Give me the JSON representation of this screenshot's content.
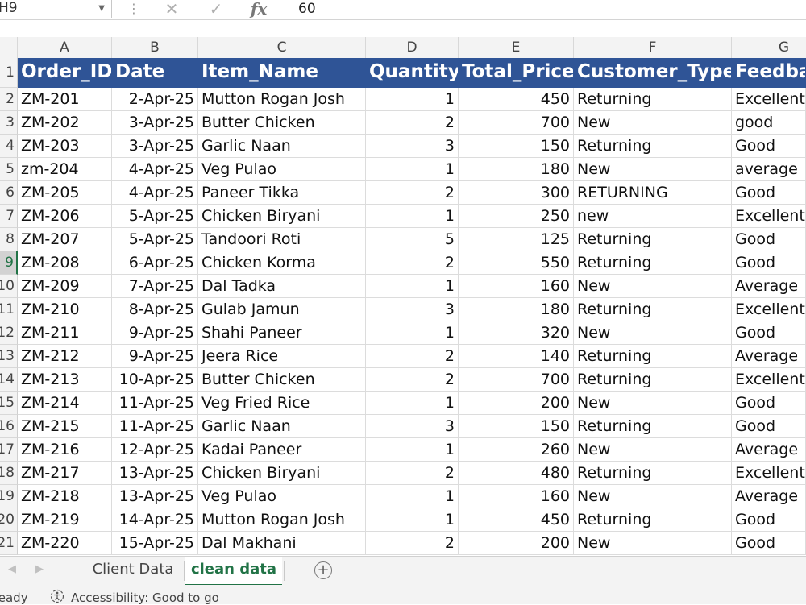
{
  "formula_bar": {
    "cell_ref": "H9",
    "value": "60"
  },
  "columns": [
    "A",
    "B",
    "C",
    "D",
    "E",
    "F",
    "G"
  ],
  "row_numbers": [
    "1",
    "2",
    "3",
    "4",
    "5",
    "6",
    "7",
    "8",
    "9",
    "10",
    "11",
    "12",
    "13",
    "14",
    "15",
    "16",
    "17",
    "18",
    "19",
    "20",
    "21"
  ],
  "active_row": "9",
  "header": [
    "Order_ID",
    "Date",
    "Item_Name",
    "Quantity",
    "Total_Price",
    "Customer_Type",
    "Feedback"
  ],
  "rows": [
    [
      "ZM-201",
      "2-Apr-25",
      "Mutton Rogan Josh",
      "1",
      "450",
      "Returning",
      "Excellent"
    ],
    [
      "ZM-202",
      "3-Apr-25",
      "Butter Chicken",
      "2",
      "700",
      "New",
      "good"
    ],
    [
      "ZM-203",
      "3-Apr-25",
      "Garlic Naan",
      "3",
      "150",
      "Returning",
      "Good"
    ],
    [
      "zm-204",
      "4-Apr-25",
      "Veg Pulao",
      "1",
      "180",
      "New",
      "average"
    ],
    [
      "ZM-205",
      "4-Apr-25",
      "Paneer Tikka",
      "2",
      "300",
      "RETURNING",
      "Good"
    ],
    [
      "ZM-206",
      "5-Apr-25",
      "Chicken Biryani",
      "1",
      "250",
      "new",
      "Excellent"
    ],
    [
      "ZM-207",
      "5-Apr-25",
      "Tandoori Roti",
      "5",
      "125",
      "Returning",
      "Good"
    ],
    [
      "ZM-208",
      "6-Apr-25",
      "Chicken Korma",
      "2",
      "550",
      "Returning",
      "Good"
    ],
    [
      "ZM-209",
      "7-Apr-25",
      "Dal Tadka",
      "1",
      "160",
      "New",
      "Average"
    ],
    [
      "ZM-210",
      "8-Apr-25",
      "Gulab Jamun",
      "3",
      "180",
      "Returning",
      "Excellent"
    ],
    [
      "ZM-211",
      "9-Apr-25",
      "Shahi Paneer",
      "1",
      "320",
      "New",
      "Good"
    ],
    [
      "ZM-212",
      "9-Apr-25",
      "Jeera Rice",
      "2",
      "140",
      "Returning",
      "Average"
    ],
    [
      "ZM-213",
      "10-Apr-25",
      "Butter Chicken",
      "2",
      "700",
      "Returning",
      "Excellent"
    ],
    [
      "ZM-214",
      "11-Apr-25",
      "Veg Fried Rice",
      "1",
      "200",
      "New",
      "Good"
    ],
    [
      "ZM-215",
      "11-Apr-25",
      "Garlic Naan",
      "3",
      "150",
      "Returning",
      "Good"
    ],
    [
      "ZM-216",
      "12-Apr-25",
      "Kadai Paneer",
      "1",
      "260",
      "New",
      "Average"
    ],
    [
      "ZM-217",
      "13-Apr-25",
      "Chicken Biryani",
      "2",
      "480",
      "Returning",
      "Excellent"
    ],
    [
      "ZM-218",
      "13-Apr-25",
      "Veg Pulao",
      "1",
      "160",
      "New",
      "Average"
    ],
    [
      "ZM-219",
      "14-Apr-25",
      "Mutton Rogan Josh",
      "1",
      "450",
      "Returning",
      "Good"
    ],
    [
      "ZM-220",
      "15-Apr-25",
      "Dal Makhani",
      "2",
      "200",
      "New",
      "Good"
    ]
  ],
  "sheet_tabs": [
    {
      "label": "Client Data",
      "active": false
    },
    {
      "label": "clean data",
      "active": true
    }
  ],
  "status": {
    "ready": "Ready",
    "accessibility": "Accessibility: Good to go"
  },
  "colors": {
    "header_fill": "#2f5496",
    "active_tab": "#217346"
  }
}
